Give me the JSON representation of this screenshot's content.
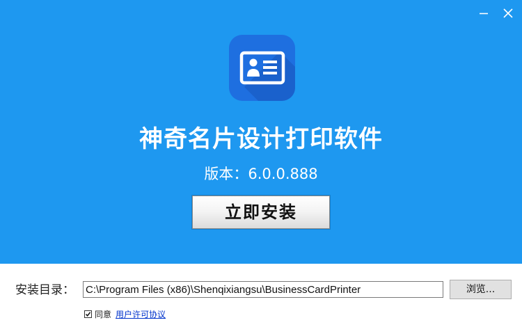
{
  "window": {
    "controls": [
      {
        "name": "minimize",
        "icon": "minimize-icon"
      },
      {
        "name": "close",
        "icon": "close-icon"
      }
    ]
  },
  "header": {
    "logo_icon": "business-card-icon",
    "title": "神奇名片设计打印软件",
    "version_label": "版本：6.0.0.888",
    "install_label": "立即安装"
  },
  "install_dir": {
    "label": "安装目录：",
    "path_value": "C:\\Program Files (x86)\\Shenqixiangsu\\BusinessCardPrinter",
    "browse_label": "浏览..."
  },
  "agreement": {
    "checked": true,
    "agree_label": "同意",
    "link_label": "用户许可协议"
  },
  "colors": {
    "banner": "#1e98f0",
    "logo_tile": "#1e6fe0",
    "link": "#0033cc"
  }
}
